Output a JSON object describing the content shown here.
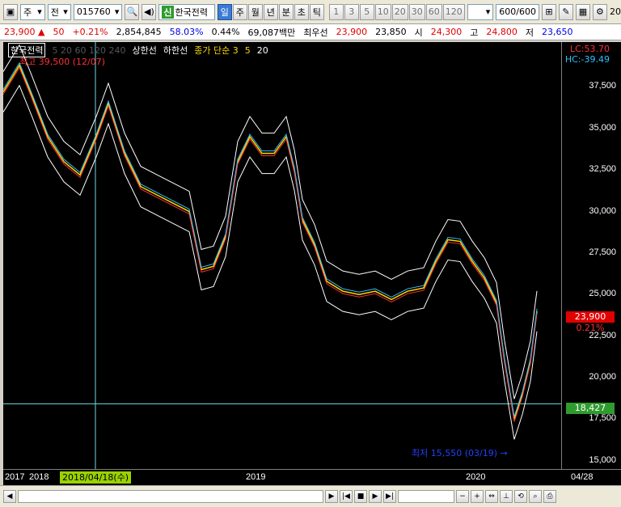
{
  "toolbar": {
    "period_select": "주",
    "market_select": "전",
    "code": "015760",
    "badge": "신",
    "stock_name": "한국전력",
    "tabs": [
      "일",
      "주",
      "월",
      "년",
      "분",
      "초",
      "틱"
    ],
    "active_tab": "일",
    "numbers": [
      "1",
      "3",
      "5",
      "10",
      "20",
      "30",
      "60",
      "120"
    ],
    "count": "600/600",
    "edge_label": "20"
  },
  "quote": {
    "price": "23,900",
    "change": "50",
    "pct": "+0.21%",
    "volume": "2,854,845",
    "vol_ratio": "58.03%",
    "turnover": "0.44%",
    "amount": "69,087백만",
    "best_label": "최우선",
    "best": "23,900",
    "best2": "23,850",
    "open_label": "시",
    "open": "24,300",
    "high_label": "고",
    "high": "24,800",
    "low_label": "저",
    "low": "23,650"
  },
  "chart": {
    "legend_name": "한국전력",
    "legend_faded": "5 20 60 120 240",
    "legend_upper": "상한선",
    "legend_lower": "하한선",
    "legend_close": "종가 단순 3",
    "legend_ma5": "5",
    "legend_ma20": "20",
    "lc": "LC:53.70",
    "hc": "HC:-39.49",
    "max_label": "최고 39,500 (12/07)",
    "min_label": "최저 15,550 (03/19) →",
    "current_price": "23,900",
    "current_pct": "0.21%",
    "cursor_price": "18,427",
    "cursor_date": "2018/04/18(수)",
    "y_ticks": [
      "37,500",
      "35,000",
      "32,500",
      "30,000",
      "27,500",
      "25,000",
      "22,500",
      "20,000",
      "17,500",
      "15,000"
    ],
    "x_ticks": [
      "2017",
      "2018",
      "2019",
      "2020",
      "04/28"
    ]
  },
  "colors": {
    "up": "#ff3030",
    "down": "#30c0ff",
    "band": "#ffffff",
    "crosshair": "#6fd8e8"
  }
}
